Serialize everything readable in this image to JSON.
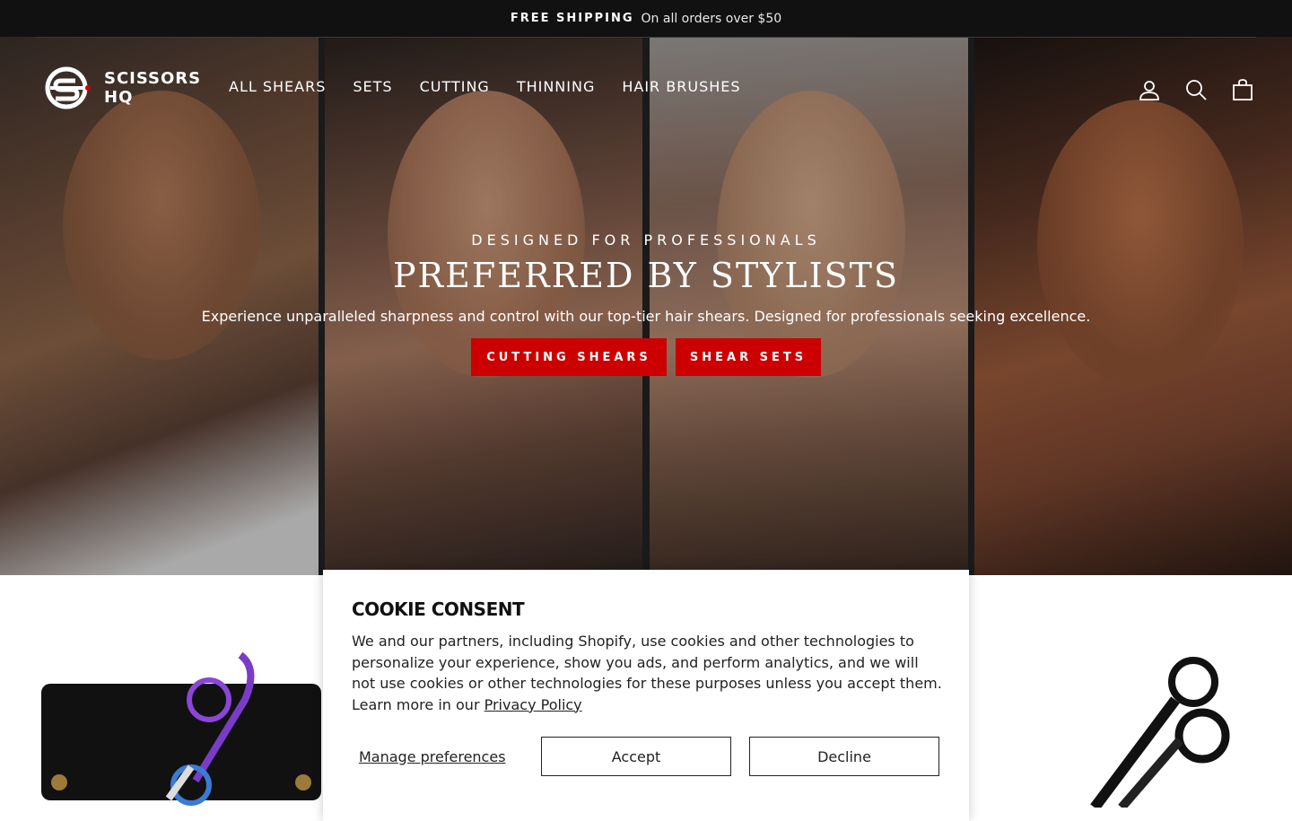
{
  "announcement": {
    "bold": "FREE SHIPPING",
    "text": "On all orders over $50"
  },
  "header": {
    "logo_text": "SCISSORS HQ",
    "nav": [
      "ALL SHEARS",
      "SETS",
      "CUTTING",
      "THINNING",
      "HAIR BRUSHES"
    ],
    "icons": [
      "user-icon",
      "search-icon",
      "bag-icon"
    ]
  },
  "hero": {
    "eyebrow": "DESIGNED FOR PROFESSIONALS",
    "headline": "PREFERRED BY STYLISTS",
    "subline": "Experience unparalleled sharpness and control with our top-tier hair shears. Designed for professionals seeking excellence.",
    "cta_primary": "CUTTING SHEARS",
    "cta_secondary": "SHEAR SETS"
  },
  "cookie": {
    "title": "COOKIE CONSENT",
    "body": "We and our partners, including Shopify, use cookies and other technologies to personalize your experience, show you ads, and perform analytics, and we will not use cookies or other technologies for these purposes unless you accept them. Learn more in our",
    "link": "Privacy Policy",
    "manage": "Manage preferences",
    "accept": "Accept",
    "decline": "Decline"
  },
  "colors": {
    "accent": "#cc0000",
    "topbar": "#111111"
  }
}
